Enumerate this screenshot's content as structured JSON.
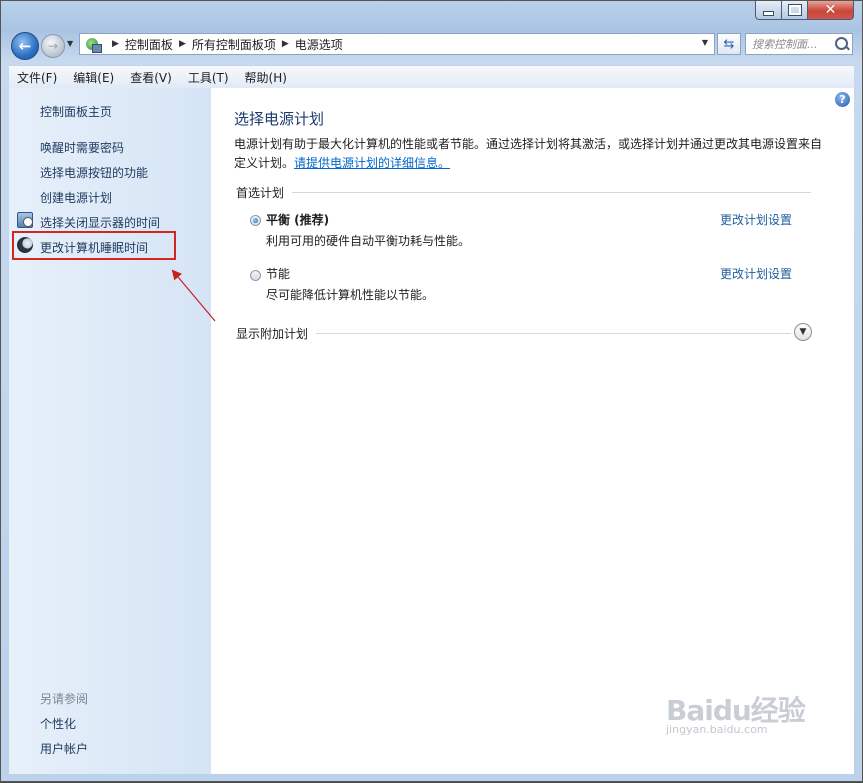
{
  "address": {
    "crumbs": [
      "控制面板",
      "所有控制面板项",
      "电源选项"
    ],
    "search_placeholder": "搜索控制面..."
  },
  "menu": [
    "文件(F)",
    "编辑(E)",
    "查看(V)",
    "工具(T)",
    "帮助(H)"
  ],
  "sidebar": {
    "home": "控制面板主页",
    "links": [
      "唤醒时需要密码",
      "选择电源按钮的功能",
      "创建电源计划",
      "选择关闭显示器的时间",
      "更改计算机睡眠时间"
    ],
    "see_also": "另请参阅",
    "see_also_links": [
      "个性化",
      "用户帐户"
    ]
  },
  "main": {
    "title": "选择电源计划",
    "desc_text": "电源计划有助于最大化计算机的性能或者节能。通过选择计划将其激活，或选择计划并通过更改其电源设置来自定义计划。",
    "desc_link": "请提供电源计划的详细信息。",
    "preferred_header": "首选计划",
    "plans": [
      {
        "name": "平衡 (推荐)",
        "desc": "利用可用的硬件自动平衡功耗与性能。",
        "link": "更改计划设置",
        "selected": true
      },
      {
        "name": "节能",
        "desc": "尽可能降低计算机性能以节能。",
        "link": "更改计划设置",
        "selected": false
      }
    ],
    "more_header": "显示附加计划"
  },
  "watermark": {
    "main": "Baidu经验",
    "sub": "jingyan.baidu.com"
  },
  "colors": {
    "highlight": "#d2261e",
    "link": "#0066cc",
    "title": "#1e3b6e"
  }
}
